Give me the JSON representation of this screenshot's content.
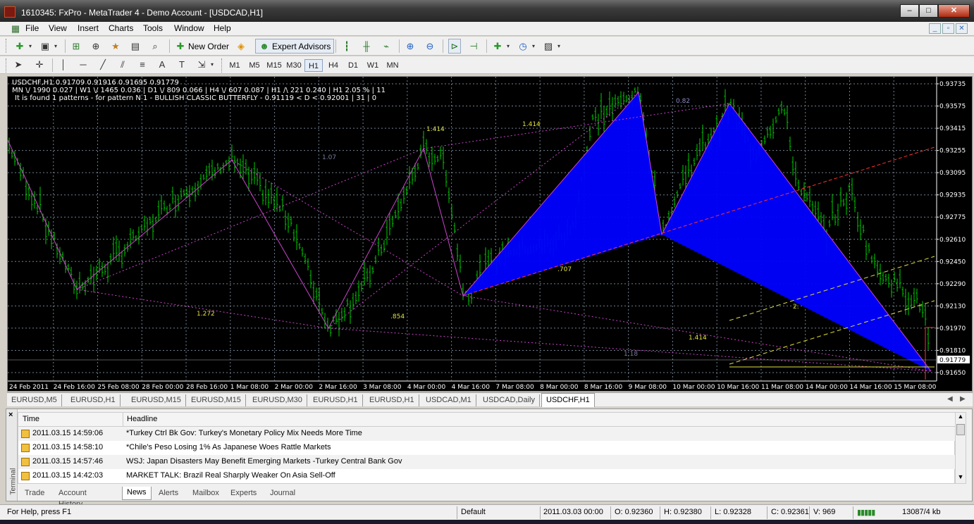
{
  "window": {
    "title": "1610345: FxPro - MetaTrader 4 - Demo Account - [USDCAD,H1]",
    "controls": [
      "–",
      "□",
      "✕"
    ]
  },
  "menu": [
    "File",
    "View",
    "Insert",
    "Charts",
    "Tools",
    "Window",
    "Help"
  ],
  "mdi_controls": [
    "_",
    "▫",
    "✕"
  ],
  "toolbar": {
    "new_order": "New Order",
    "expert_advisors": "Expert Advisors"
  },
  "timeframes": [
    "M1",
    "M5",
    "M15",
    "M30",
    "H1",
    "H4",
    "D1",
    "W1",
    "MN"
  ],
  "active_timeframe": "H1",
  "chart": {
    "info_line1": "USDCHF,H1  0.91709 0.91916 0.91695 0.91779",
    "info_line2": "MN \\/ 1990   0.027  |  W1 \\/ 1465   0.036  |  D1 \\/ 809   0.066  |  H4 \\/ 607   0.087  |  H1 /\\ 221   0.240  |  H1  2.05 %  |  11",
    "info_line3": "It is found 1 patterns -  for pattern N 1 - BULLISH CLASSIC BUTTERFLY - 0.91119 < D < 0.92001 | 31 | 0",
    "price_labels": [
      "0.93735",
      "0.93575",
      "0.93415",
      "0.93255",
      "0.93095",
      "0.92935",
      "0.92775",
      "0.92610",
      "0.92450",
      "0.92290",
      "0.92130",
      "0.91970",
      "0.91810",
      "0.91650"
    ],
    "current_price": "0.91779",
    "time_labels": [
      "24 Feb 2011",
      "24 Feb 16:00",
      "25 Feb 08:00",
      "28 Feb 00:00",
      "28 Feb 16:00",
      "1 Mar 08:00",
      "2 Mar 00:00",
      "2 Mar 16:00",
      "3 Mar 08:00",
      "4 Mar 00:00",
      "4 Mar 16:00",
      "7 Mar 08:00",
      "8 Mar 00:00",
      "8 Mar 16:00",
      "9 Mar 08:00",
      "10 Mar 00:00",
      "10 Mar 16:00",
      "11 Mar 08:00",
      "14 Mar 00:00",
      "14 Mar 16:00",
      "15 Mar 08:00"
    ],
    "ratio_labels": [
      "1.414",
      "1.414",
      "1.07",
      "0.82",
      "1.272",
      ".854",
      ".707",
      "1.414",
      "1.18",
      "2."
    ],
    "colors": {
      "bull": "#00cc00",
      "pattern_fill": "#0000ff",
      "zigzag": "#cc44cc",
      "grid": "#708090",
      "red_line": "#ff3030",
      "yellow_line": "#e0e040"
    }
  },
  "chart_tabs": [
    "EURUSD,M5",
    "EURUSD,H1",
    "EURUSD,M15",
    "EURUSD,M15",
    "EURUSD,M30",
    "EURUSD,H1",
    "EURUSD,H1",
    "USDCAD,M1",
    "USDCAD,Daily",
    "USDCHF,H1"
  ],
  "active_chart_tab": "USDCHF,H1",
  "terminal": {
    "side_label": "Terminal",
    "close": "×",
    "columns": {
      "time": "Time",
      "headline": "Headline"
    },
    "news": [
      {
        "time": "2011.03.15 14:59:06",
        "headline": "*Turkey Ctrl Bk Gov: Turkey's Monetary Policy Mix Needs More Time"
      },
      {
        "time": "2011.03.15 14:58:10",
        "headline": "*Chile's Peso Losing 1% As Japanese Woes Rattle Markets"
      },
      {
        "time": "2011.03.15 14:57:46",
        "headline": "WSJ: Japan Disasters May Benefit Emerging Markets -Turkey Central Bank Gov"
      },
      {
        "time": "2011.03.15 14:42:03",
        "headline": "MARKET TALK: Brazil Real Sharply Weaker On Asia Sell-Off"
      }
    ],
    "tabs": [
      "Trade",
      "Account History",
      "News",
      "Alerts",
      "Mailbox",
      "Experts",
      "Journal"
    ],
    "active_tab": "News"
  },
  "status": {
    "help": "For Help, press F1",
    "profile": "Default",
    "datetime": "2011.03.03 00:00",
    "open": "O: 0.92360",
    "high": "H: 0.92380",
    "low": "L: 0.92328",
    "close": "C: 0.92361",
    "volume": "V: 969",
    "traffic": "13087/4 kb"
  }
}
